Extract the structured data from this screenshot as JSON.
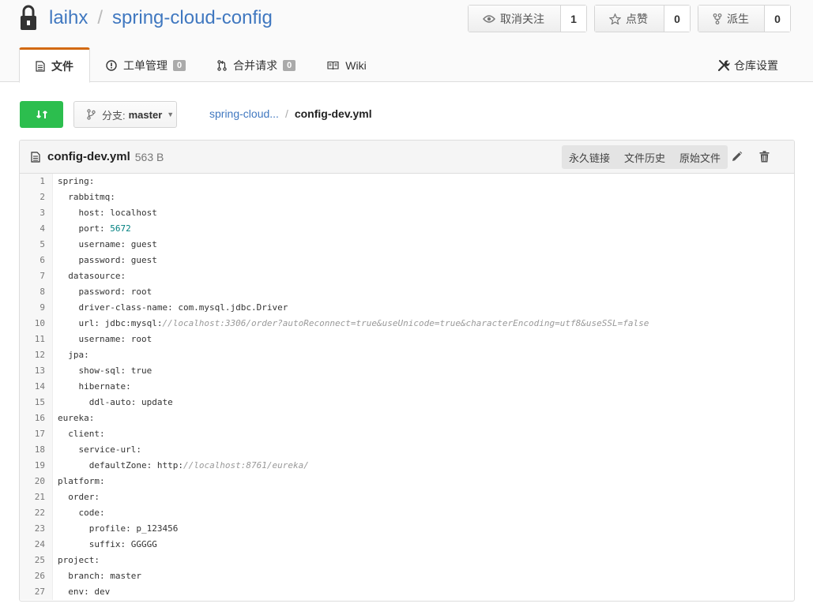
{
  "repo": {
    "owner": "laihx",
    "separator": "/",
    "name": "spring-cloud-config"
  },
  "actions": {
    "watch": {
      "label": "取消关注",
      "count": "1"
    },
    "star": {
      "label": "点赞",
      "count": "0"
    },
    "fork": {
      "label": "派生",
      "count": "0"
    }
  },
  "tabs": [
    {
      "label": "文件"
    },
    {
      "label": "工单管理",
      "badge": "0"
    },
    {
      "label": "合并请求",
      "badge": "0"
    },
    {
      "label": "Wiki"
    }
  ],
  "settings_label": "仓库设置",
  "branch": {
    "prefix": "分支:",
    "name": "master"
  },
  "breadcrumb": {
    "parent": "spring-cloud...",
    "separator": "/",
    "current": "config-dev.yml"
  },
  "file": {
    "name": "config-dev.yml",
    "size": "563 B",
    "actions": [
      "永久链接",
      "文件历史",
      "原始文件"
    ]
  },
  "code_lines": [
    [
      "spring:",
      ""
    ],
    [
      "  rabbitmq:",
      ""
    ],
    [
      "    host: localhost",
      ""
    ],
    [
      "    port: ",
      "5672"
    ],
    [
      "    username: guest",
      ""
    ],
    [
      "    password: guest",
      ""
    ],
    [
      "  datasource:",
      ""
    ],
    [
      "    password: root",
      ""
    ],
    [
      "    driver-class-name: com.mysql.jdbc.Driver",
      ""
    ],
    [
      "    url: jdbc:mysql:",
      "//localhost:3306/order?autoReconnect=true&useUnicode=true&characterEncoding=utf8&useSSL=false"
    ],
    [
      "    username: root",
      ""
    ],
    [
      "  jpa:",
      ""
    ],
    [
      "    show-sql: true",
      ""
    ],
    [
      "    hibernate:",
      ""
    ],
    [
      "      ddl-auto: update",
      ""
    ],
    [
      "eureka:",
      ""
    ],
    [
      "  client:",
      ""
    ],
    [
      "    service-url:",
      ""
    ],
    [
      "      defaultZone: http:",
      "//localhost:8761/eureka/"
    ],
    [
      "platform:",
      ""
    ],
    [
      "  order:",
      ""
    ],
    [
      "    code:",
      ""
    ],
    [
      "      profile: p_123456",
      ""
    ],
    [
      "      suffix: GGGGG",
      ""
    ],
    [
      "project:",
      ""
    ],
    [
      "  branch: master",
      ""
    ],
    [
      "  env: dev",
      ""
    ]
  ],
  "colors": {
    "accent_green": "#2cbe4e",
    "link": "#4078c0",
    "tab_active": "#d26911"
  }
}
